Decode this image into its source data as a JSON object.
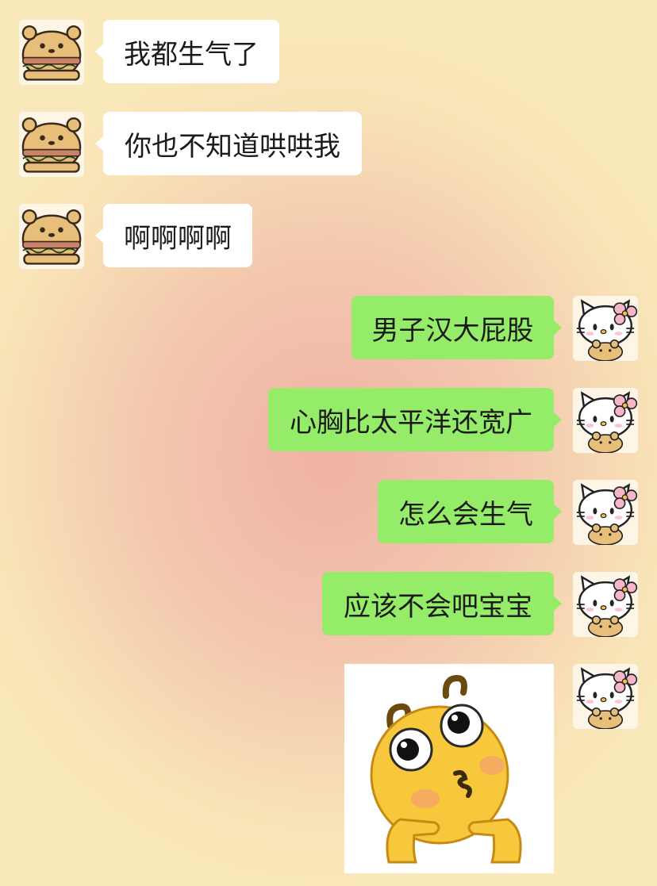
{
  "chat": {
    "messages": [
      {
        "side": "in",
        "text": "我都生气了",
        "avatar_icon": "burger-bear-avatar"
      },
      {
        "side": "in",
        "text": "你也不知道哄哄我",
        "avatar_icon": "burger-bear-avatar"
      },
      {
        "side": "in",
        "text": "啊啊啊啊",
        "avatar_icon": "burger-bear-avatar"
      },
      {
        "side": "out",
        "text": "男子汉大屁股",
        "avatar_icon": "hello-kitty-avatar"
      },
      {
        "side": "out",
        "text": "心胸比太平洋还宽广",
        "avatar_icon": "hello-kitty-avatar"
      },
      {
        "side": "out",
        "text": "怎么会生气",
        "avatar_icon": "hello-kitty-avatar"
      },
      {
        "side": "out",
        "text": "应该不会吧宝宝",
        "avatar_icon": "hello-kitty-avatar"
      },
      {
        "side": "out",
        "type": "sticker",
        "sticker_icon": "pouting-emoji-sticker",
        "avatar_icon": "hello-kitty-avatar"
      }
    ]
  },
  "colors": {
    "incoming_bubble": "#ffffff",
    "outgoing_bubble": "#95ec69",
    "background_center": "#efb2a4",
    "background_edge": "#f9e9ba"
  }
}
